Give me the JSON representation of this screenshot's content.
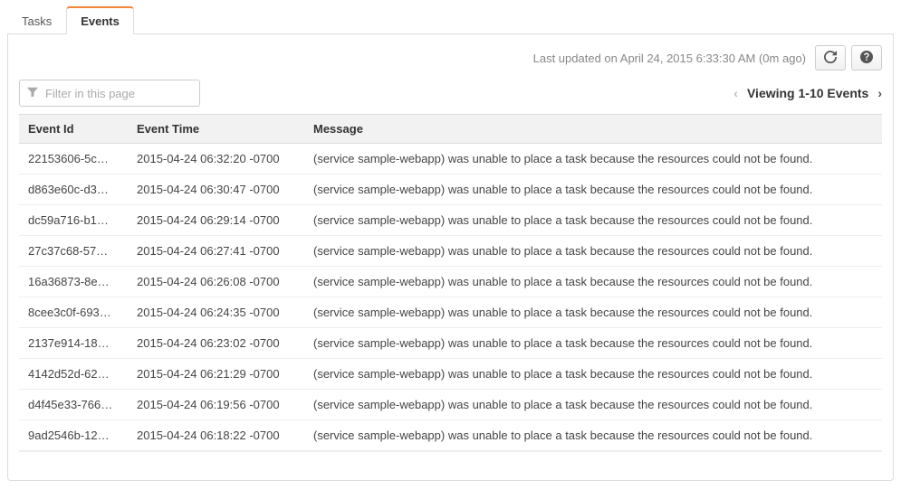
{
  "tabs": {
    "tasks": "Tasks",
    "events": "Events"
  },
  "status": {
    "last_updated": "Last updated on April 24, 2015 6:33:30 AM (0m ago)"
  },
  "filter": {
    "placeholder": "Filter in this page"
  },
  "pager": {
    "label": "Viewing 1-10 Events"
  },
  "table": {
    "headers": {
      "event_id": "Event Id",
      "event_time": "Event Time",
      "message": "Message"
    },
    "rows": [
      {
        "id": "22153606-5c…",
        "time": "2015-04-24 06:32:20 -0700",
        "msg": "(service sample-webapp) was unable to place a task because the resources could not be found."
      },
      {
        "id": "d863e60c-d3…",
        "time": "2015-04-24 06:30:47 -0700",
        "msg": "(service sample-webapp) was unable to place a task because the resources could not be found."
      },
      {
        "id": "dc59a716-b1…",
        "time": "2015-04-24 06:29:14 -0700",
        "msg": "(service sample-webapp) was unable to place a task because the resources could not be found."
      },
      {
        "id": "27c37c68-57…",
        "time": "2015-04-24 06:27:41 -0700",
        "msg": "(service sample-webapp) was unable to place a task because the resources could not be found."
      },
      {
        "id": "16a36873-8e…",
        "time": "2015-04-24 06:26:08 -0700",
        "msg": "(service sample-webapp) was unable to place a task because the resources could not be found."
      },
      {
        "id": "8cee3c0f-693…",
        "time": "2015-04-24 06:24:35 -0700",
        "msg": "(service sample-webapp) was unable to place a task because the resources could not be found."
      },
      {
        "id": "2137e914-18…",
        "time": "2015-04-24 06:23:02 -0700",
        "msg": "(service sample-webapp) was unable to place a task because the resources could not be found."
      },
      {
        "id": "4142d52d-62…",
        "time": "2015-04-24 06:21:29 -0700",
        "msg": "(service sample-webapp) was unable to place a task because the resources could not be found."
      },
      {
        "id": "d4f45e33-766…",
        "time": "2015-04-24 06:19:56 -0700",
        "msg": "(service sample-webapp) was unable to place a task because the resources could not be found."
      },
      {
        "id": "9ad2546b-12…",
        "time": "2015-04-24 06:18:22 -0700",
        "msg": "(service sample-webapp) was unable to place a task because the resources could not be found."
      }
    ]
  }
}
